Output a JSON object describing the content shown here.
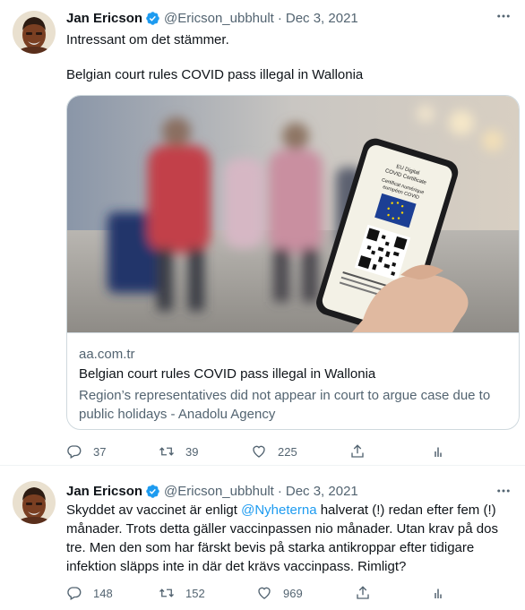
{
  "tweets": [
    {
      "author": "Jan Ericson",
      "handle": "@Ericson_ubbhult",
      "separator": "·",
      "date": "Dec 3, 2021",
      "text_line1": "Intressant om det stämmer.",
      "text_line2": "Belgian court rules COVID pass illegal in Wallonia",
      "card": {
        "domain": "aa.com.tr",
        "title": "Belgian court rules COVID pass illegal in Wallonia",
        "description": "Region’s representatives did not appear in court to argue case due to public holidays - Anadolu Agency",
        "image_caption_lines": [
          "EU Digital",
          "COVID Certificate",
          "Certificat numérique",
          "européen COVID"
        ]
      },
      "replies": "37",
      "retweets": "39",
      "likes": "225"
    },
    {
      "author": "Jan Ericson",
      "handle": "@Ericson_ubbhult",
      "separator": "·",
      "date": "Dec 3, 2021",
      "text_before_mention": "Skyddet av vaccinet är enligt ",
      "mention": "@Nyheterna",
      "text_after_mention": " halverat (!) redan efter fem (!) månader. Trots detta gäller vaccinpassen nio månader. Utan krav på dos tre. Men den som har färskt bevis på starka antikroppar efter tidigare infektion släpps inte in där det krävs vaccinpass. Rimligt?",
      "replies": "148",
      "retweets": "152",
      "likes": "969"
    }
  ],
  "icons": {
    "verified": "verified-badge-icon",
    "more": "more-dots-icon",
    "reply": "reply-icon",
    "retweet": "retweet-icon",
    "like": "heart-icon",
    "share": "share-icon",
    "analytics": "analytics-icon"
  },
  "colors": {
    "verified": "#1d9bf0",
    "mention": "#1d9bf0",
    "secondary_text": "#536471",
    "border": "#cfd9de"
  }
}
